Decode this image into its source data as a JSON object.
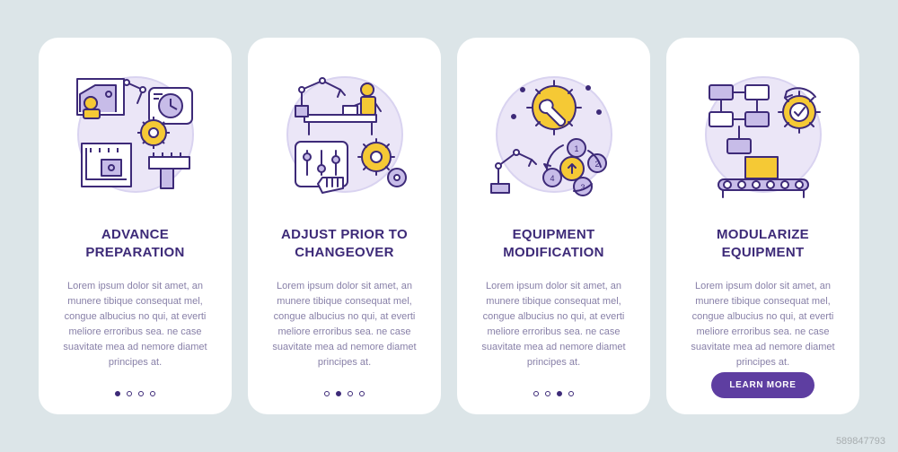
{
  "cards": [
    {
      "title": "Advance Preparation",
      "desc": "Lorem ipsum dolor sit amet, an munere tibique consequat mel, congue albucius no qui, at everti meliore erroribus sea. ne case suavitate mea ad nemore diamet principes at.",
      "activeDot": 0,
      "hasButton": false
    },
    {
      "title": "Adjust Prior to Changeover",
      "desc": "Lorem ipsum dolor sit amet, an munere tibique consequat mel, congue albucius no qui, at everti meliore erroribus sea. ne case suavitate mea ad nemore diamet principes at.",
      "activeDot": 1,
      "hasButton": false
    },
    {
      "title": "Equipment Modification",
      "desc": "Lorem ipsum dolor sit amet, an munere tibique consequat mel, congue albucius no qui, at everti meliore erroribus sea. ne case suavitate mea ad nemore diamet principes at.",
      "activeDot": 2,
      "hasButton": false
    },
    {
      "title": "Modularize Equipment",
      "desc": "Lorem ipsum dolor sit amet, an munere tibique consequat mel, congue albucius no qui, at everti meliore erroribus sea. ne case suavitate mea ad nemore diamet principes at.",
      "activeDot": 3,
      "hasButton": true
    }
  ],
  "button": {
    "label": "LEARN MORE"
  },
  "watermark": "589847793"
}
